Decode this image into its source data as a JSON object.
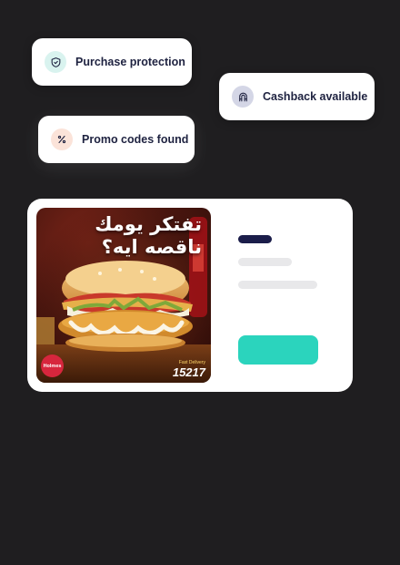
{
  "chips": {
    "purchase_protection": {
      "label": "Purchase protection",
      "icon": "shield-icon",
      "color": "#d9f3ef"
    },
    "cashback": {
      "label": "Cashback available",
      "icon": "magnet-icon",
      "color": "#d4d6e6"
    },
    "promo_codes": {
      "label": "Promo codes found",
      "icon": "percent-icon",
      "color": "#fbe3d9"
    }
  },
  "ad": {
    "headline_line1": "تفتكر يومك",
    "headline_line2": "ناقصه ايه؟",
    "brand_logo_text": "Holmes",
    "phone_caption": "Fast Delivery",
    "phone_number": "15217",
    "image_subject": "chicken burger"
  },
  "colors": {
    "background": "#1f1e20",
    "card": "#ffffff",
    "skeleton_title": "#1b1d4a",
    "skeleton_line": "#e8e8ea",
    "cta": "#2bd4bd"
  }
}
